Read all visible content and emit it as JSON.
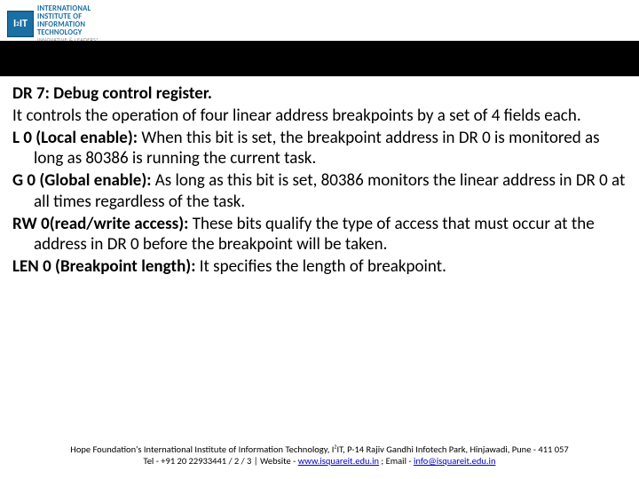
{
  "logo": {
    "mark_html": "I<sup>2</sup>IT",
    "line1": "INTERNATIONAL",
    "line2": "INSTITUTE OF",
    "line3": "INFORMATION",
    "line4": "TECHNOLOGY",
    "tagline": "INNOVATIVE & LEADERS®"
  },
  "body": {
    "title": "DR 7: Debug control register.",
    "p1": "It controls the operation of four linear address breakpoints by a set of 4 fields each.",
    "l0_label": "L 0 (Local enable): ",
    "l0_text": "When this bit is set, the breakpoint address in DR 0 is monitored as long as 80386 is running the current task.",
    "g0_label": "G 0 (Global enable): ",
    "g0_text": "As long as this bit is set, 80386 monitors the linear address in DR 0 at all times regardless of the task.",
    "rw0_label": "RW 0(read/write access): ",
    "rw0_text": "These bits qualify the type of access that must occur at the address in DR 0 before the breakpoint will be taken.",
    "len0_label": "LEN 0 (Breakpoint length): ",
    "len0_text": "It specifies the length of breakpoint."
  },
  "footer": {
    "line1_pre": "Hope Foundation's International Institute of Information Technology, I",
    "line1_sup": "2",
    "line1_post": "IT, P-14 Rajiv Gandhi Infotech Park, Hinjawadi, Pune - 411 057",
    "line2_pre": "Tel - +91 20 22933441 / 2 / 3  |  Website - ",
    "website": "www.isquareit.edu.in",
    "line2_mid": " ; Email - ",
    "email": "info@isquareit.edu.in"
  }
}
